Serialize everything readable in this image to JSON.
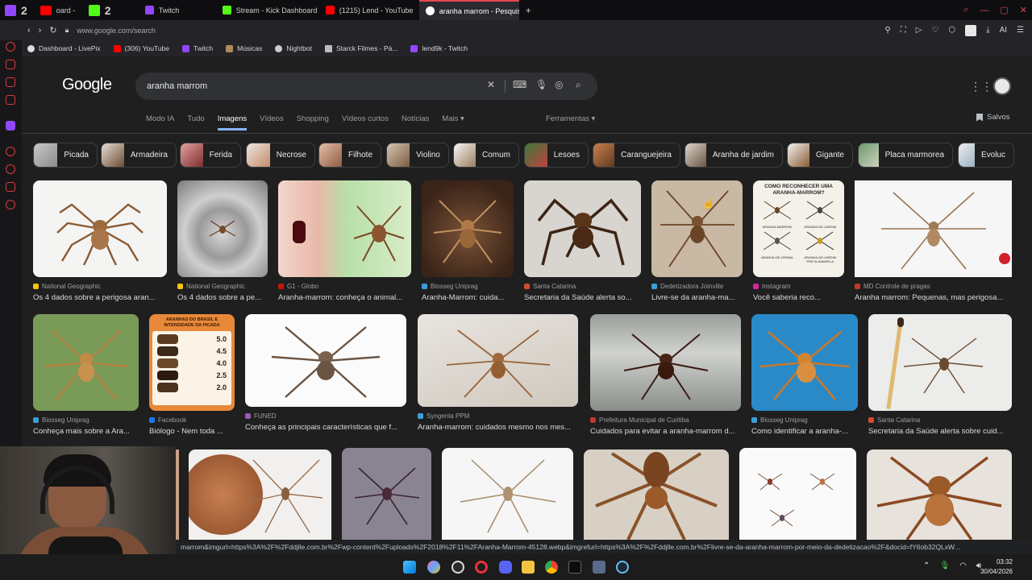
{
  "tabs": [
    {
      "label": "2",
      "type": "twitch"
    },
    {
      "label": "oard - ",
      "type": "mixed"
    },
    {
      "label": "1",
      "type": "yt"
    },
    {
      "label": "2",
      "type": "kick"
    },
    {
      "label": "Twitch"
    },
    {
      "label": "Stream - Kick Dashboard"
    },
    {
      "label": "(1215) Lend - YouTube"
    },
    {
      "label": "aranha marrom - Pesquisa"
    }
  ],
  "address": {
    "url": "www.google.com/search",
    "ai_label": "AI"
  },
  "bookmarks": [
    "Dashboard - LivePix",
    "(306) YouTube",
    "Twitch",
    "Músicas",
    "Nightbot",
    "Starck Filmes - Pá...",
    "lend9k - Twitch"
  ],
  "google": {
    "logo": "Google",
    "query": "aranha marrom",
    "tabs": [
      "Modo IA",
      "Tudo",
      "Imagens",
      "Vídeos",
      "Shopping",
      "Vídeos curtos",
      "Notícias",
      "Mais ▾"
    ],
    "tools": "Ferramentas ▾",
    "saved": "Salvos"
  },
  "chips": [
    "Picada",
    "Armadeira",
    "Ferida",
    "Necrose",
    "Filhote",
    "Violino",
    "Comum",
    "Lesoes",
    "Caranguejeira",
    "Aranha de jardim",
    "Gigante",
    "Placa marmorea",
    "Evoluc"
  ],
  "row1": [
    {
      "source": "National Geographic",
      "title": "Os 4 dados sobre a perigosa aran...",
      "color": "#f1c40f"
    },
    {
      "source": "National Geographic",
      "title": "Os 4 dados sobre a pe...",
      "color": "#f1c40f"
    },
    {
      "source": "G1 - Globo",
      "title": "Aranha-marrom: conheça o animal...",
      "color": "#c4170c"
    },
    {
      "source": "Biosseg Uniprag",
      "title": "Aranha-Marrom: cuida...",
      "color": "#3aa0d8"
    },
    {
      "source": "Santa Catarina",
      "title": "Secretaria da Saúde alerta so...",
      "color": "#d14b2e"
    },
    {
      "source": "Dedetizadora Joinville",
      "title": "Livre-se da aranha-ma...",
      "color": "#3aa0d8"
    },
    {
      "source": "Instagram",
      "title": "Você saberia reco...",
      "color": "#d6249f"
    },
    {
      "source": "MD Controle de pragas",
      "title": "Aranha marrom: Pequenas, mas perigosa...",
      "color": "#c0392b"
    }
  ],
  "row2": [
    {
      "source": "Biosseg Uniprag",
      "title": "Conheça mais sobre a Ara...",
      "color": "#3aa0d8"
    },
    {
      "source": "Facebook",
      "title": "Biólogo - Nem toda ...",
      "color": "#1877f2"
    },
    {
      "source": "FUNED",
      "title": "Conheça as principais características que f...",
      "color": "#9b59b6"
    },
    {
      "source": "Syngenta PPM",
      "title": "Aranha-marrom: cuidados mesmo nos mes...",
      "color": "#3aa0d8"
    },
    {
      "source": "Prefeitura Municipal de Curitiba",
      "title": "Cuidados para evitar a aranha-marrom d...",
      "color": "#c0392b"
    },
    {
      "source": "Biosseg Uniprag",
      "title": "Como identificar a aranha-...",
      "color": "#3aa0d8"
    },
    {
      "source": "Santa Catarina",
      "title": "Secretaria da Saúde alerta sobre cuid...",
      "color": "#d14b2e"
    }
  ],
  "infographic1": {
    "title": "COMO RECONHECER UMA ARANHA-MARROM?",
    "labels": [
      "ARANHA-MARROM",
      "ARANHA-DE-JARDIM",
      "ARANHA-DE-GRAMA",
      "ARANHA-DE-JARDIM PRETA-AMARELA"
    ]
  },
  "infographic2": {
    "title": "ARANHAS DO BRASIL E INTENSIDADE DA PICADA",
    "values": [
      "5.0",
      "4.5",
      "4.0",
      "2.5",
      "2.0"
    ]
  },
  "status_url": "marrom&imgurl=https%3A%2F%2Fddjlle.com.br%2Fwp-content%2Fuploads%2F2018%2F11%2FAranha-Marrom-45128.webp&imgrefurl=https%3A%2F%2Fddjlle.com.br%2Flivre-se-da-aranha-marrom-por-meio-da-dedetizacao%2F&docid=fY6ob32QLxW...",
  "clock": {
    "time": "03:32",
    "date": "30/04/2026"
  }
}
